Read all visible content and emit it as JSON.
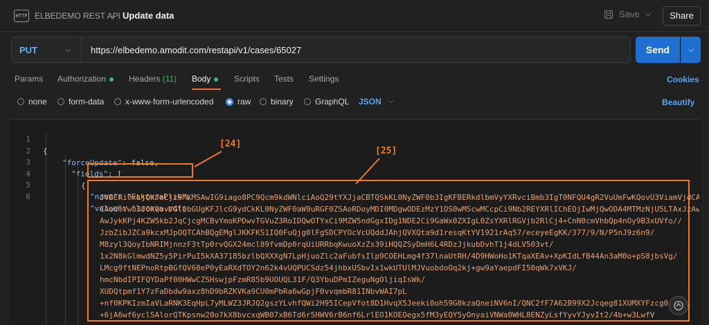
{
  "header": {
    "collection": "ELBEDEMO REST API",
    "separator": "/",
    "title": "Update data",
    "save_label": "Save",
    "share_label": "Share",
    "icon": "http-icon"
  },
  "request": {
    "method": "PUT",
    "url": "https://elbedemo.amodit.com/restapi/v1/cases/65027",
    "send_label": "Send"
  },
  "tabs": [
    {
      "label": "Params"
    },
    {
      "label": "Authorization",
      "dot": true
    },
    {
      "label": "Headers",
      "count": "(11)"
    },
    {
      "label": "Body",
      "dot": true,
      "active": true
    },
    {
      "label": "Scripts"
    },
    {
      "label": "Tests"
    },
    {
      "label": "Settings"
    }
  ],
  "cookies_label": "Cookies",
  "body_options": {
    "items": [
      "none",
      "form-data",
      "x-www-form-urlencoded",
      "raw",
      "binary",
      "GraphQL"
    ],
    "selected": "raw",
    "format": "JSON",
    "beautify_label": "Beautify"
  },
  "editor": {
    "line_numbers": [
      "1",
      "2",
      "3",
      "4",
      "5",
      "6"
    ],
    "line1": "{",
    "line2_key": "\"forceUpdate\"",
    "line2_val": "false",
    "line3_key": "\"fields\"",
    "line3_val": "[",
    "line4": "{",
    "line5_key": "\"name\"",
    "line5_val": "\"FakturaPlik\"",
    "line6_key": "\"value\"",
    "line6_val": "\"lacava.pdf;",
    "base64_lines": [
      "JVBERi0xLjQKJeLjz9MKMSAwIG9iago8PC9Qcm9kdWNlciAoQ29tYXJjaCBTQSkKL0NyZWF0b3IgKFBERkdlbmVyYXRvciBmb3IgT0NFQU4gR2VuUmFwKQovU3ViamVjdCAoKQovVGl0bGUgKFJlcG9ydCkKL0NyZWF0aW9uRGF0ZSAo",
      "CAoUmVwb3J0KQovVGl0bGUgKFJlcG9ydCkKL0NyZWF0aW9uRGF0ZSAoRDoyMDI0MDgwODEzMzY1OS0wMScwMCcpCi9Nb2REYXRlIChEOjIwMjQwODA4MTMzNjU5LTAxJzAwJykKPj4KZW5kb2JqCjIgMCBvYmoKPDwvVHlwZS9Q",
      "AwJykKPj4KZW5kb2JqCjcgMCBvYmoKPDwvTGVuZ3RoIDQwOTYxCi9MZW5ndGgxIDg1NDE2Ci9GaWx0ZXIgL0ZsYXRlRGVjb2RlCj4+CnN0cmVhbQp4nOy9B3xUVfo//",
      "JzbZibJZCa9kcxMJpOQTCAhBQgEMglJKKFKS1IQ0FuQjg0lFgSDCPYOcVcUQddJAhjQVXQta9d1resqKtYV1921rAq57/eceyeEgKK/377/9/N/P5nJ9z6n9/",
      "M8zyl3QoyIbNRIMjnnzF3tTp0rvQGX24mcl89fvmDp0rqUiURRbqKwuoXzZs39iHQQZSyDmH6L4RDzJjkubDvhT1j4dLV503vt/",
      "1x2N8kGlmwdNZ5y5PirPuI5kXA37185bzlbQXXXgN7LpHjuoZlc2aFubfsIlp9COEHLmg4f37lnaUtRH/4D9HWoHo1KTqaXEAv+XpKIdLfB44An3aM0o+pS8jbsVg/",
      "LMcg9ftNEPnoRtpBGfQV60eP0yEaRXdTOY2n62k4vUQPUCSdz54jhbxUSbvIx1wkUTUlMJVuobdoOq2kj+gw9aYaepdFI50qWk7xVKJ/",
      "hmcNbdIPIFQYDaPf00HWwCZSHswjpFzmR85b9UOUQL31F/Q3YbuDPmIZeguNgOljiqIsWk/",
      "XUDQtpmf1Y7zFaDbdw9axz8hD9bRZKVKa9CU0mPbRa6wGpjF0vvqmbR81INbvWAI7pL",
      "+nf0KPKIzmIaVLaRNK3EqHpL7yMLWZ3JRJQ2gszYLvhfQWi2H95ICepVfot8D1HvqX5Jeeki0oh59G0kzaQneiNV6nI/QNC2fF7A62B99X2Jcqeg81XUMXYFzcg0",
      "+6jA6wf6yclSAlorQTKpsnw20o7kX8bvcxqWB07xB6Td6r5HWV6rB6nf6LrlEO1KOEOegx5fM3yEQY5yOnyaiVNWa0WHL8ENZyLsfYyvYJyvIt2/4b+w3LwfV"
    ]
  },
  "annotations": {
    "label24": "[24]",
    "label25": "[25]"
  }
}
